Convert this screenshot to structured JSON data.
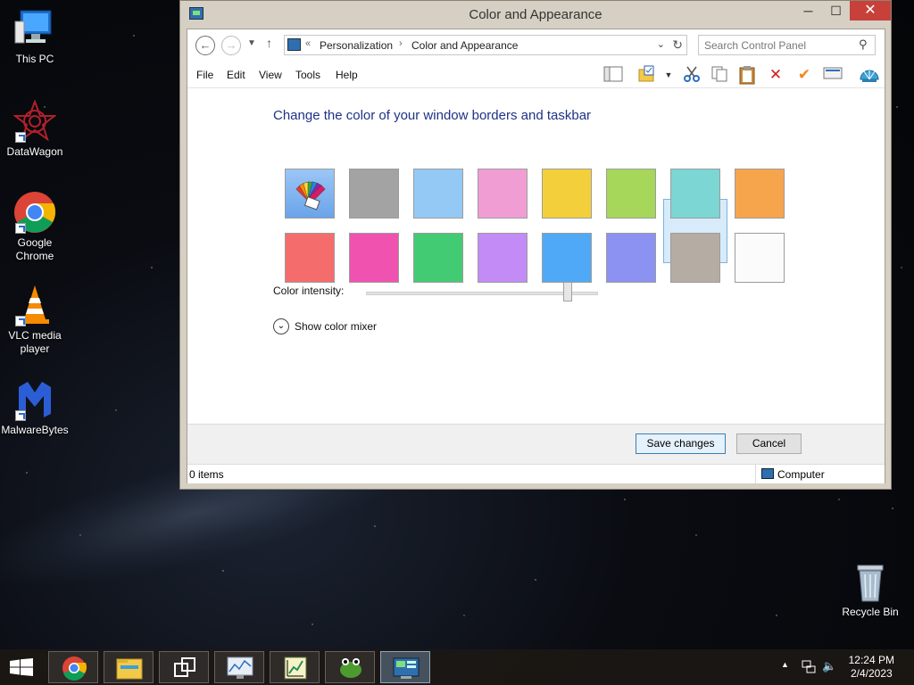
{
  "desktop": {
    "icons": [
      {
        "label": "This PC"
      },
      {
        "label": "DataWagon"
      },
      {
        "label": "Google Chrome"
      },
      {
        "label": "VLC media player"
      },
      {
        "label": "MalwareBytes"
      },
      {
        "label": "Recycle Bin"
      }
    ]
  },
  "window": {
    "title": "Color and Appearance",
    "buttons": {
      "minimize": "─",
      "maximize": "☐",
      "close": "✕"
    },
    "address": {
      "overflow": "«",
      "crumbs": [
        "Personalization",
        "Color and Appearance"
      ],
      "separator": "›"
    },
    "search": {
      "placeholder": "Search Control Panel"
    },
    "menu": [
      "File",
      "Edit",
      "View",
      "Tools",
      "Help"
    ],
    "toolbar_icons": [
      "layout-icon",
      "folder-options-icon",
      "dropdown-arrow-icon",
      "cut-icon",
      "copy-icon",
      "paste-icon",
      "delete-icon",
      "check-icon",
      "properties-icon",
      "shell-icon"
    ],
    "content": {
      "heading": "Change the color of your window borders and taskbar",
      "swatches": [
        {
          "name": "automatic",
          "color": "#8ab8f0"
        },
        {
          "name": "gray",
          "color": "#a3a3a3"
        },
        {
          "name": "light-blue",
          "color": "#94c9f5"
        },
        {
          "name": "pink",
          "color": "#f09dd4"
        },
        {
          "name": "yellow",
          "color": "#f3d03b"
        },
        {
          "name": "lime",
          "color": "#a6d65a"
        },
        {
          "name": "teal",
          "color": "#7bd6d4"
        },
        {
          "name": "orange",
          "color": "#f6a54c"
        },
        {
          "name": "red",
          "color": "#f56c6c"
        },
        {
          "name": "magenta",
          "color": "#f052b0"
        },
        {
          "name": "green",
          "color": "#43cb74"
        },
        {
          "name": "purple",
          "color": "#c38bf5"
        },
        {
          "name": "blue",
          "color": "#4fa9f7"
        },
        {
          "name": "periwinkle",
          "color": "#8c92f2"
        },
        {
          "name": "taupe",
          "color": "#b5aca3",
          "selected": true
        },
        {
          "name": "white",
          "color": "#fbfbfb"
        }
      ],
      "intensity_label": "Color intensity:",
      "intensity_value": 0.87,
      "mixer_label": "Show color mixer"
    },
    "save_label": "Save changes",
    "cancel_label": "Cancel",
    "status": {
      "items": "0 items",
      "location": "Computer"
    }
  },
  "taskbar": {
    "apps": [
      "start-button",
      "chrome",
      "file-explorer",
      "task-view",
      "performance-monitor",
      "graph-app",
      "frog-app",
      "control-panel"
    ],
    "active_app": "control-panel",
    "time": "12:24 PM",
    "date": "2/4/2023"
  }
}
